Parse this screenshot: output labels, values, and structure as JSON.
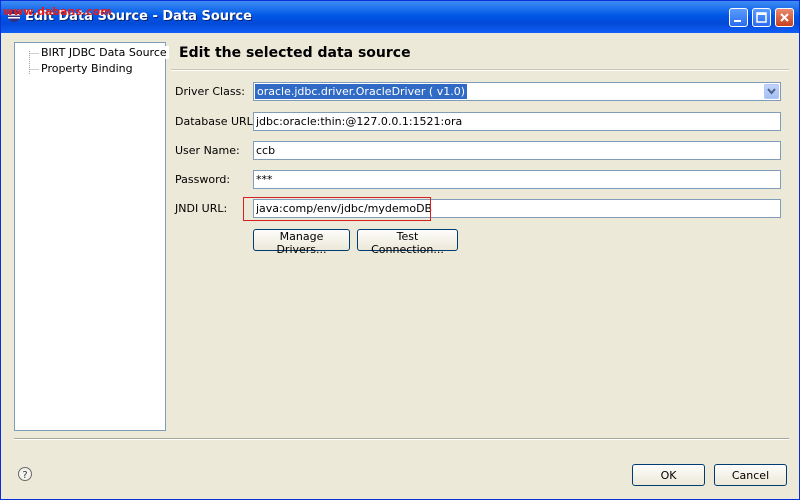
{
  "window": {
    "title": "Edit Data Source - Data Source",
    "watermark": "www.dabans.com"
  },
  "tree": {
    "items": [
      {
        "label": "BIRT JDBC Data Source",
        "selected": true
      },
      {
        "label": "Property Binding",
        "selected": false
      }
    ]
  },
  "main": {
    "header": "Edit the selected data source",
    "driver_class": {
      "label": "Driver Class:",
      "value": "oracle.jdbc.driver.OracleDriver ( v1.0)"
    },
    "database_url": {
      "label": "Database URL:",
      "value": "jdbc:oracle:thin:@127.0.0.1:1521:ora"
    },
    "user_name": {
      "label": "User Name:",
      "value": "ccb"
    },
    "password": {
      "label": "Password:",
      "value": "***"
    },
    "jndi_url": {
      "label": "JNDI URL:",
      "value": "java:comp/env/jdbc/mydemoDB"
    },
    "manage_drivers_label": "Manage Drivers...",
    "test_connection_label": "Test Connection..."
  },
  "footer": {
    "ok_label": "OK",
    "cancel_label": "Cancel",
    "help_icon": "?"
  },
  "colors": {
    "titlebar": "#0058e6",
    "selection": "#316ac5",
    "highlight_border": "#d62020",
    "watermark": "#e31b1b"
  }
}
